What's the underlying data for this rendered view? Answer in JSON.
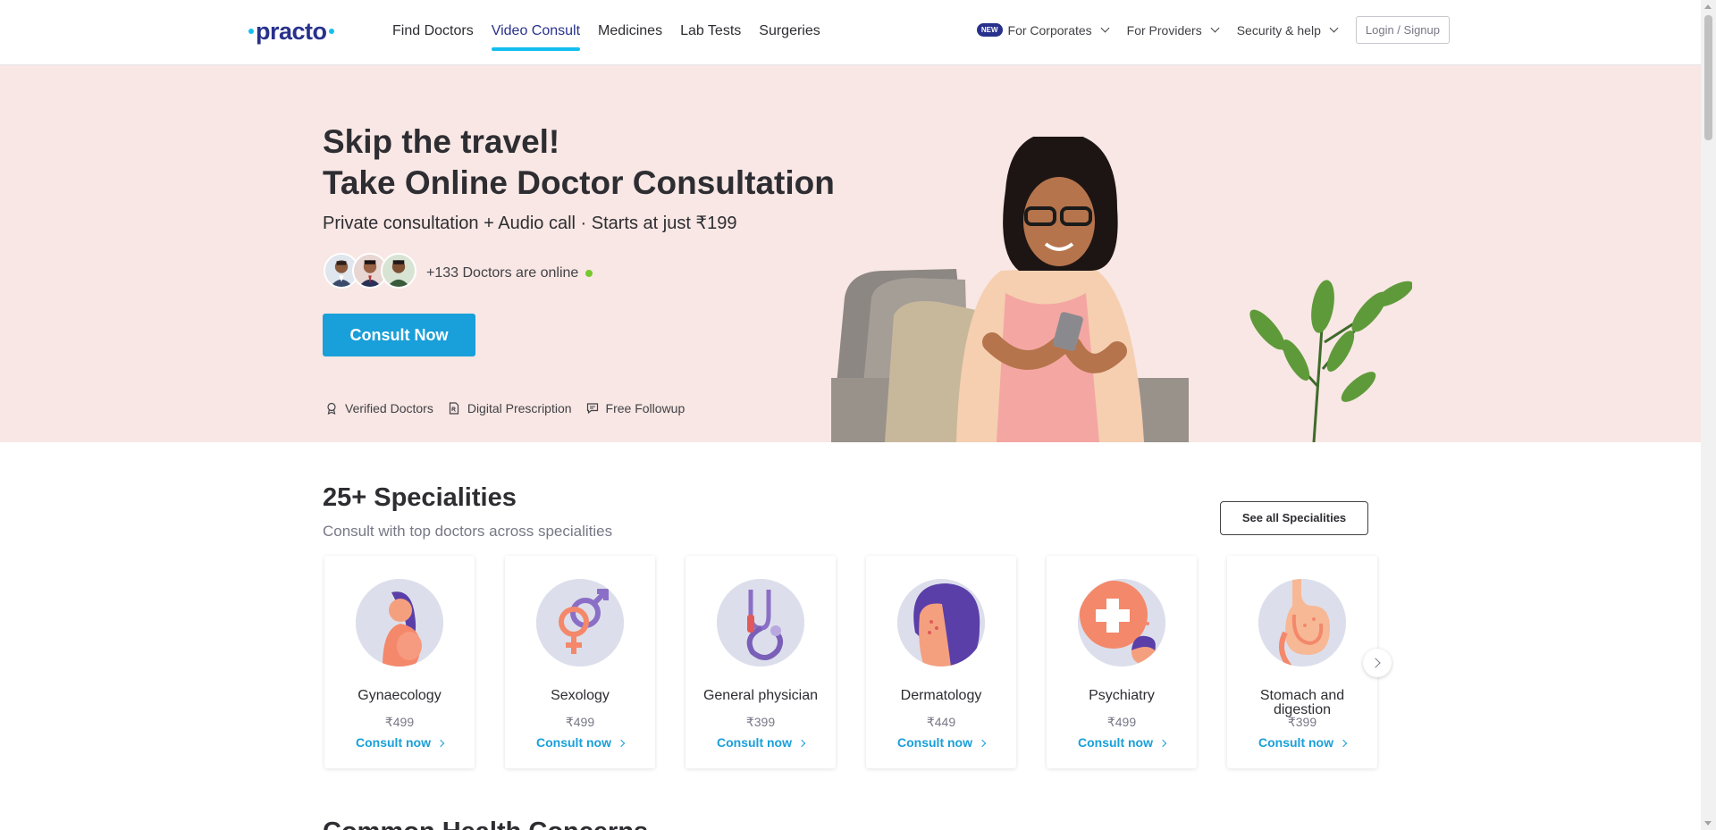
{
  "header": {
    "logo": "practo",
    "nav": [
      "Find Doctors",
      "Video Consult",
      "Medicines",
      "Lab Tests",
      "Surgeries"
    ],
    "active_nav": "Video Consult",
    "new_badge": "NEW",
    "for_corporates": "For Corporates",
    "for_providers": "For Providers",
    "security_help": "Security & help",
    "login": "Login / Signup"
  },
  "hero": {
    "title_line1": "Skip the travel!",
    "title_line2": "Take Online Doctor Consultation",
    "subtitle": "Private consultation + Audio call · Starts at just ₹199",
    "online_text": "+133 Doctors are online",
    "cta": "Consult Now",
    "features": [
      "Verified Doctors",
      "Digital Prescription",
      "Free Followup"
    ],
    "background_color": "#f8e7e4",
    "cta_color": "#199fd9"
  },
  "specialities": {
    "title": "25+ Specialities",
    "subtitle": "Consult with top doctors across specialities",
    "see_all": "See all Specialities",
    "items": [
      {
        "name": "Gynaecology",
        "price": "₹499",
        "link": "Consult now"
      },
      {
        "name": "Sexology",
        "price": "₹499",
        "link": "Consult now"
      },
      {
        "name": "General physician",
        "price": "₹399",
        "link": "Consult now"
      },
      {
        "name": "Dermatology",
        "price": "₹449",
        "link": "Consult now"
      },
      {
        "name": "Psychiatry",
        "price": "₹499",
        "link": "Consult now"
      },
      {
        "name": "Stomach and digestion",
        "price": "₹399",
        "link": "Consult now"
      }
    ]
  },
  "next_section": {
    "title_partial": "Common Health Concerns"
  }
}
